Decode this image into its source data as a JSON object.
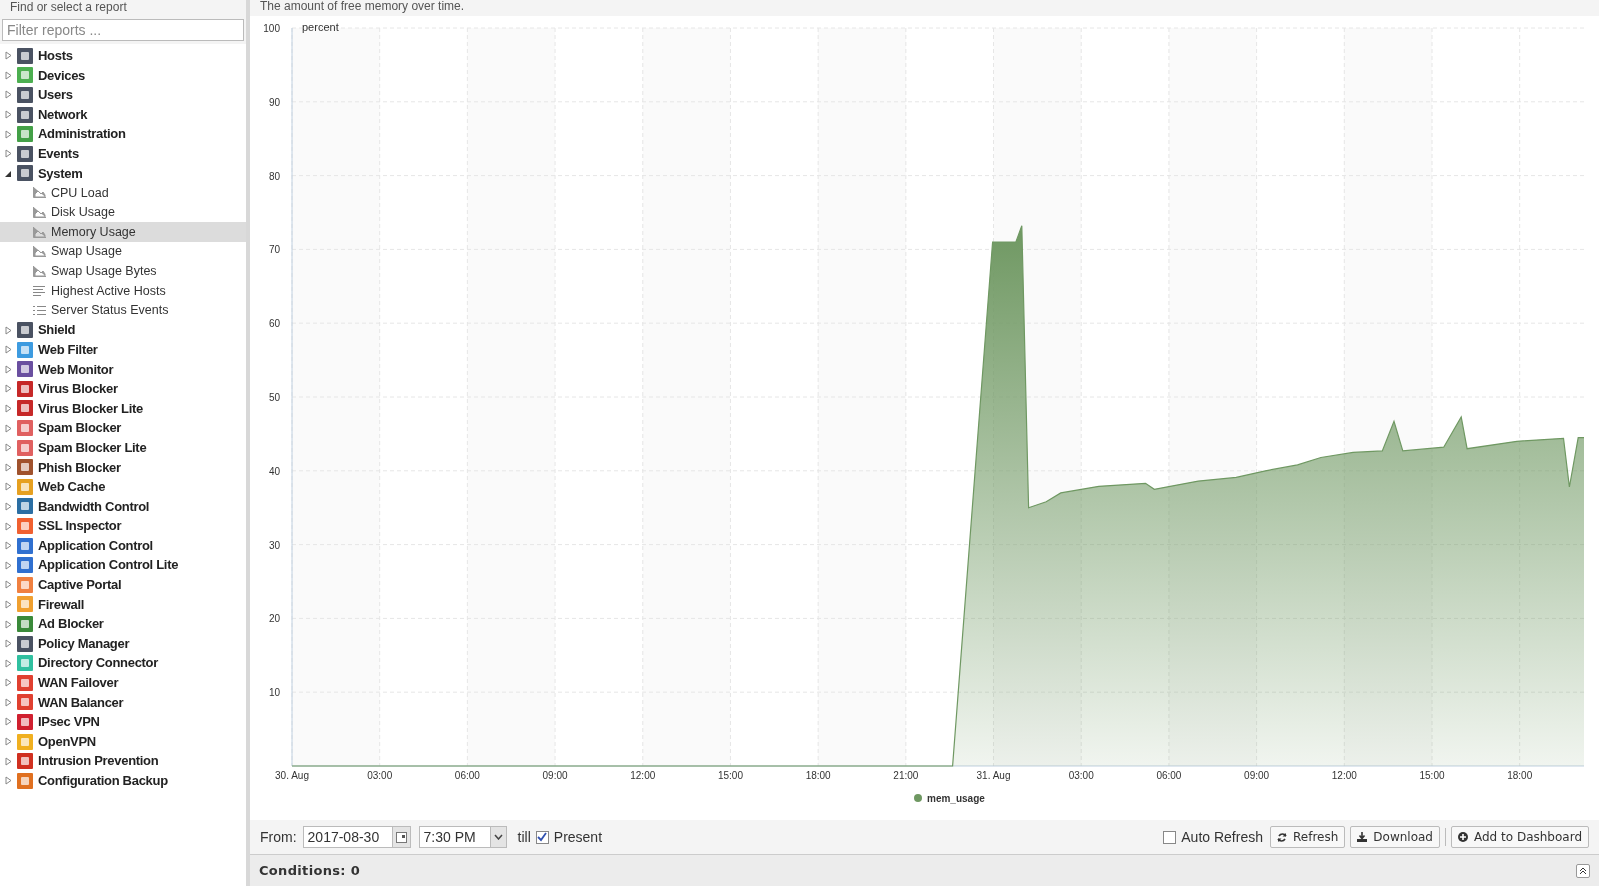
{
  "sidebar": {
    "title": "Find or select a report",
    "filter": {
      "placeholder": "Filter reports ..."
    },
    "items": [
      {
        "label": "Hosts",
        "color": "#4a5262",
        "expanded": false
      },
      {
        "label": "Devices",
        "color": "#4caf50",
        "expanded": false
      },
      {
        "label": "Users",
        "color": "#4a5262",
        "expanded": false
      },
      {
        "label": "Network",
        "color": "#4a5262",
        "expanded": false
      },
      {
        "label": "Administration",
        "color": "#43a047",
        "expanded": false
      },
      {
        "label": "Events",
        "color": "#4a5262",
        "expanded": false
      },
      {
        "label": "System",
        "color": "#4a5262",
        "expanded": true,
        "children": [
          {
            "label": "CPU Load",
            "kind": "chart",
            "selected": false
          },
          {
            "label": "Disk Usage",
            "kind": "chart",
            "selected": false
          },
          {
            "label": "Memory Usage",
            "kind": "chart",
            "selected": true
          },
          {
            "label": "Swap Usage",
            "kind": "chart",
            "selected": false
          },
          {
            "label": "Swap Usage Bytes",
            "kind": "chart",
            "selected": false
          },
          {
            "label": "Highest Active Hosts",
            "kind": "bars",
            "selected": false
          },
          {
            "label": "Server Status Events",
            "kind": "list",
            "selected": false
          }
        ]
      },
      {
        "label": "Shield",
        "color": "#4a5262",
        "expanded": false
      },
      {
        "label": "Web Filter",
        "color": "#3d9be0",
        "expanded": false
      },
      {
        "label": "Web Monitor",
        "color": "#6a4fa0",
        "expanded": false
      },
      {
        "label": "Virus Blocker",
        "color": "#c62828",
        "expanded": false
      },
      {
        "label": "Virus Blocker Lite",
        "color": "#c62828",
        "expanded": false
      },
      {
        "label": "Spam Blocker",
        "color": "#e06060",
        "expanded": false
      },
      {
        "label": "Spam Blocker Lite",
        "color": "#e06060",
        "expanded": false
      },
      {
        "label": "Phish Blocker",
        "color": "#a0522d",
        "expanded": false
      },
      {
        "label": "Web Cache",
        "color": "#e6a020",
        "expanded": false
      },
      {
        "label": "Bandwidth Control",
        "color": "#2b6ea3",
        "expanded": false
      },
      {
        "label": "SSL Inspector",
        "color": "#f06030",
        "expanded": false
      },
      {
        "label": "Application Control",
        "color": "#3070d0",
        "expanded": false
      },
      {
        "label": "Application Control Lite",
        "color": "#3070d0",
        "expanded": false
      },
      {
        "label": "Captive Portal",
        "color": "#f08040",
        "expanded": false
      },
      {
        "label": "Firewall",
        "color": "#f0a030",
        "expanded": false
      },
      {
        "label": "Ad Blocker",
        "color": "#3a8a3a",
        "expanded": false
      },
      {
        "label": "Policy Manager",
        "color": "#4a5262",
        "expanded": false
      },
      {
        "label": "Directory Connector",
        "color": "#30c0a0",
        "expanded": false
      },
      {
        "label": "WAN Failover",
        "color": "#e04030",
        "expanded": false
      },
      {
        "label": "WAN Balancer",
        "color": "#e04030",
        "expanded": false
      },
      {
        "label": "IPsec VPN",
        "color": "#d02030",
        "expanded": false
      },
      {
        "label": "OpenVPN",
        "color": "#f0b020",
        "expanded": false
      },
      {
        "label": "Intrusion Prevention",
        "color": "#d03020",
        "expanded": false
      },
      {
        "label": "Configuration Backup",
        "color": "#e07020",
        "expanded": false
      }
    ]
  },
  "report": {
    "description": "The amount of free memory over time.",
    "chart_data": {
      "type": "area",
      "ylabel": "percent",
      "x": [
        "2017-08-30T00:00",
        "2017-08-30T22:36",
        "2017-08-30T23:58",
        "2017-08-31T00:46",
        "2017-08-31T00:58",
        "2017-08-31T01:12",
        "2017-08-31T01:48",
        "2017-08-31T02:18",
        "2017-08-31T03:36",
        "2017-08-31T05:12",
        "2017-08-31T05:30",
        "2017-08-31T07:00",
        "2017-08-31T08:18",
        "2017-08-31T09:18",
        "2017-08-31T10:24",
        "2017-08-31T11:12",
        "2017-08-31T12:18",
        "2017-08-31T13:18",
        "2017-08-31T13:42",
        "2017-08-31T14:00",
        "2017-08-31T15:24",
        "2017-08-31T16:00",
        "2017-08-31T16:12",
        "2017-08-31T17:54",
        "2017-08-31T19:30",
        "2017-08-31T19:42",
        "2017-08-31T20:00",
        "2017-08-31T20:12"
      ],
      "series": [
        {
          "name": "mem_usage",
          "color": "#6f9862",
          "values": [
            0,
            0,
            71,
            71,
            73.2,
            35,
            35.8,
            37,
            37.9,
            38.3,
            37.5,
            38.6,
            39.1,
            40,
            40.8,
            41.8,
            42.5,
            42.7,
            46.7,
            42.7,
            43.2,
            47.3,
            43,
            44,
            44.4,
            37.8,
            44.5,
            44.5
          ]
        }
      ],
      "xlim": [
        "2017-08-30T00:00",
        "2017-08-31T20:12"
      ],
      "ylim": [
        0,
        100
      ],
      "grid": true,
      "xticks": [
        {
          "value": "2017-08-30T00:00",
          "label": "30. Aug"
        },
        {
          "value": "2017-08-30T03:00",
          "label": "03:00"
        },
        {
          "value": "2017-08-30T06:00",
          "label": "06:00"
        },
        {
          "value": "2017-08-30T09:00",
          "label": "09:00"
        },
        {
          "value": "2017-08-30T12:00",
          "label": "12:00"
        },
        {
          "value": "2017-08-30T15:00",
          "label": "15:00"
        },
        {
          "value": "2017-08-30T18:00",
          "label": "18:00"
        },
        {
          "value": "2017-08-30T21:00",
          "label": "21:00"
        },
        {
          "value": "2017-08-31T00:00",
          "label": "31. Aug"
        },
        {
          "value": "2017-08-31T03:00",
          "label": "03:00"
        },
        {
          "value": "2017-08-31T06:00",
          "label": "06:00"
        },
        {
          "value": "2017-08-31T09:00",
          "label": "09:00"
        },
        {
          "value": "2017-08-31T12:00",
          "label": "12:00"
        },
        {
          "value": "2017-08-31T15:00",
          "label": "15:00"
        },
        {
          "value": "2017-08-31T18:00",
          "label": "18:00"
        }
      ],
      "yticks": [
        10,
        20,
        30,
        40,
        50,
        60,
        70,
        80,
        90,
        100
      ]
    }
  },
  "toolbar": {
    "from_label": "From:",
    "date": "2017-08-30",
    "time": "7:30 PM",
    "till_label": "till",
    "present": {
      "label": "Present",
      "checked": true
    },
    "auto_refresh": {
      "label": "Auto Refresh",
      "checked": false
    },
    "buttons": [
      {
        "kind": "refresh",
        "label": "Refresh"
      },
      {
        "kind": "download",
        "label": "Download"
      },
      {
        "kind": "add",
        "label": "Add to Dashboard"
      }
    ]
  },
  "conditions": "Conditions: 0"
}
